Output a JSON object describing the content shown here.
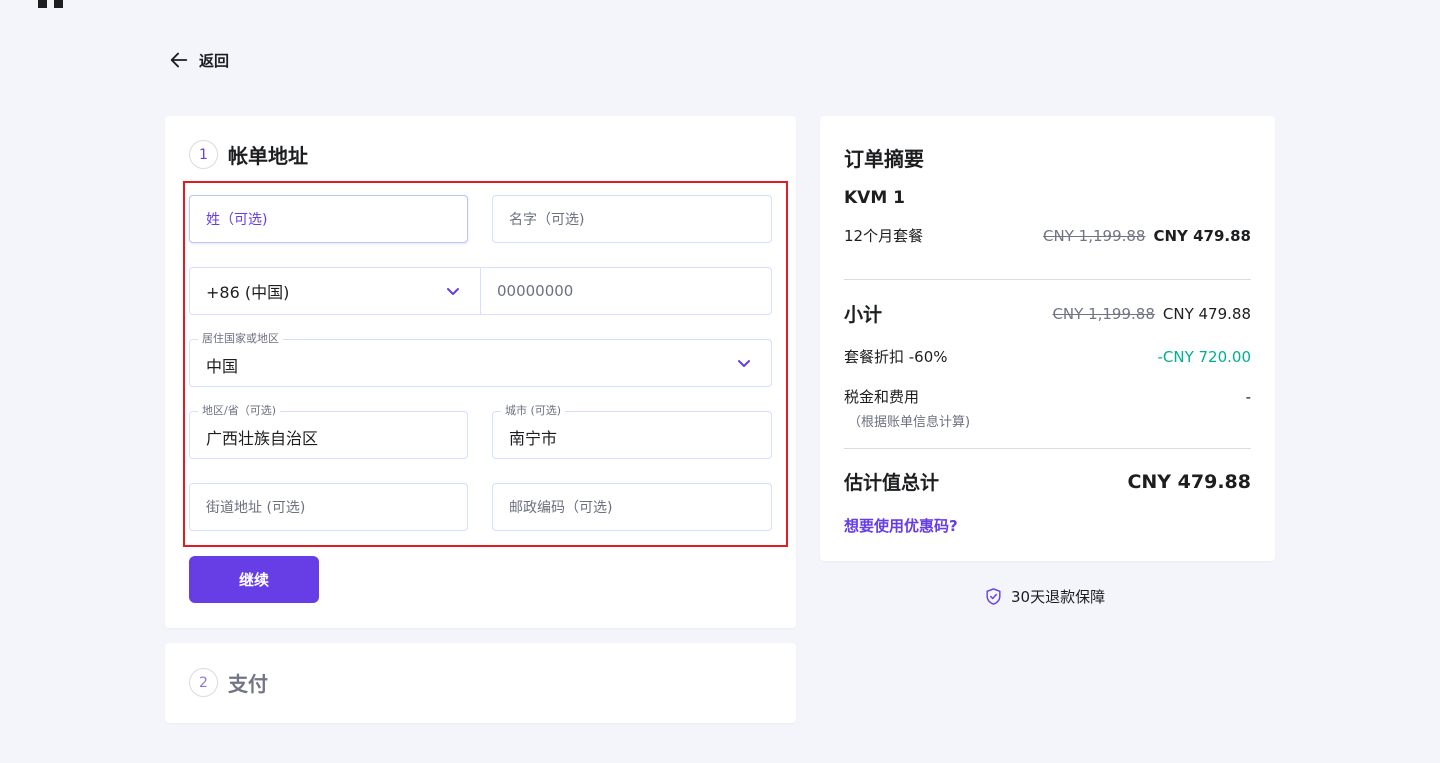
{
  "nav": {
    "back_label": "返回"
  },
  "billing": {
    "step_number": "1",
    "title": "帐单地址",
    "last_name": {
      "placeholder": "姓（可选)"
    },
    "first_name": {
      "placeholder": "名字（可选)"
    },
    "phone_code": {
      "value": "+86 (中国)"
    },
    "phone_number": {
      "placeholder": "00000000"
    },
    "country": {
      "label": "居住国家或地区",
      "value": "中国"
    },
    "region": {
      "label": "地区/省（可选)",
      "value": "广西壮族自治区"
    },
    "city": {
      "label": "城市 (可选)",
      "value": "南宁市"
    },
    "street": {
      "placeholder": "街道地址 (可选)"
    },
    "postcode": {
      "placeholder": "邮政编码（可选)"
    },
    "continue_label": "继续"
  },
  "payment": {
    "step_number": "2",
    "title": "支付"
  },
  "summary": {
    "title": "订单摘要",
    "product": "KVM 1",
    "plan_label": "12个月套餐",
    "plan_old_price": "CNY 1,199.88",
    "plan_price": "CNY 479.88",
    "subtotal_label": "小计",
    "subtotal_old_price": "CNY 1,199.88",
    "subtotal_price": "CNY 479.88",
    "discount_label": "套餐折扣 -60%",
    "discount_value": "-CNY 720.00",
    "tax_label": "税金和费用",
    "tax_value": "-",
    "tax_note": "（根据账单信息计算)",
    "total_label": "估计值总计",
    "total_value": "CNY 479.88",
    "promo_link": "想要使用优惠码?"
  },
  "guarantee": {
    "text": "30天退款保障"
  },
  "colors": {
    "accent": "#673de6",
    "discount": "#00b090",
    "highlight": "#e31b23",
    "background": "#f4f4fb"
  },
  "icons": [
    "back-arrow-icon",
    "chevron-down-icon",
    "shield-check-icon"
  ]
}
